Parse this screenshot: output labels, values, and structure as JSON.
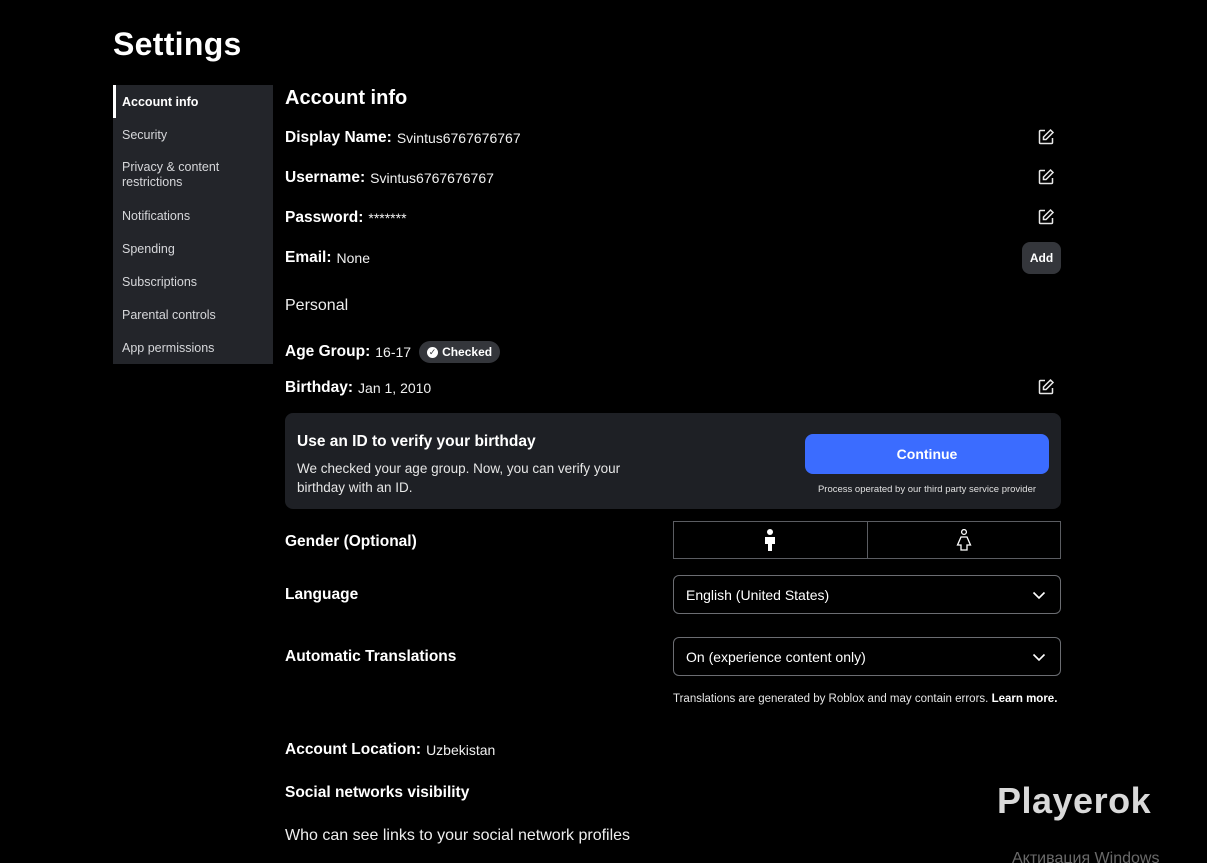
{
  "page": {
    "title": "Settings"
  },
  "sidebar": {
    "items": [
      {
        "label": "Account info",
        "active": true
      },
      {
        "label": "Security"
      },
      {
        "label": "Privacy & content restrictions"
      },
      {
        "label": "Notifications"
      },
      {
        "label": "Spending"
      },
      {
        "label": "Subscriptions"
      },
      {
        "label": "Parental controls"
      },
      {
        "label": "App permissions"
      }
    ]
  },
  "account": {
    "section_title": "Account info",
    "display_name": {
      "label": "Display Name:",
      "value": "Svintus6767676767"
    },
    "username": {
      "label": "Username:",
      "value": "Svintus6767676767"
    },
    "password": {
      "label": "Password:",
      "value": "*******"
    },
    "email": {
      "label": "Email:",
      "value": "None",
      "add_label": "Add"
    }
  },
  "personal": {
    "section_title": "Personal",
    "age_group": {
      "label": "Age Group:",
      "value": "16-17",
      "badge": "Checked"
    },
    "birthday": {
      "label": "Birthday:",
      "value": "Jan 1, 2010"
    },
    "verify": {
      "title": "Use an ID to verify your birthday",
      "description": "We checked your age group. Now, you can verify your birthday with an ID.",
      "button": "Continue",
      "note": "Process operated by our third party service provider"
    },
    "gender": {
      "label": "Gender (Optional)",
      "options": [
        "male-icon",
        "female-icon"
      ],
      "selected": "male-icon"
    },
    "language": {
      "label": "Language",
      "selected": "English (United States)"
    },
    "translations": {
      "label": "Automatic Translations",
      "selected": "On (experience content only)",
      "note": "Translations are generated by Roblox and may contain errors.",
      "learn_more": "Learn more."
    },
    "location": {
      "label": "Account Location:",
      "value": "Uzbekistan"
    }
  },
  "social": {
    "title": "Social networks visibility",
    "subtitle": "Who can see links to your social network profiles"
  },
  "overlay": {
    "watermark": "Playerok",
    "windows_notice": "Активация Windows"
  },
  "colors": {
    "accent": "#3b6cff",
    "background": "#000000",
    "sidebar": "#23252a",
    "card": "#1e2025"
  }
}
